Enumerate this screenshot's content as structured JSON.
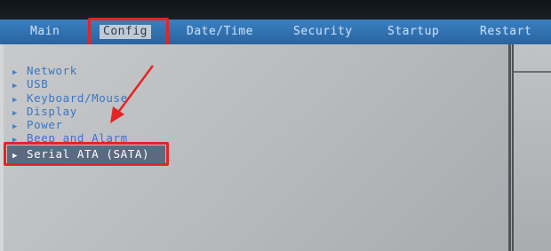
{
  "menu": {
    "tabs": [
      {
        "label": "Main"
      },
      {
        "label": "Config"
      },
      {
        "label": "Date/Time"
      },
      {
        "label": "Security"
      },
      {
        "label": "Startup"
      },
      {
        "label": "Restart"
      }
    ],
    "active_tab": "Config"
  },
  "config_menu": {
    "items": [
      {
        "label": "Network"
      },
      {
        "label": "USB"
      },
      {
        "label": "Keyboard/Mouse"
      },
      {
        "label": "Display"
      },
      {
        "label": "Power"
      },
      {
        "label": "Beep and Alarm"
      },
      {
        "label": "Serial ATA (SATA)"
      }
    ],
    "selected_item": "Serial ATA (SATA)"
  },
  "annotation": {
    "color": "#e52424",
    "arrow_icon": "red-arrow"
  },
  "colors": {
    "menubar": "#2f6fae",
    "item_text": "#3a76c2",
    "selection_bar": "#5b6a80"
  }
}
